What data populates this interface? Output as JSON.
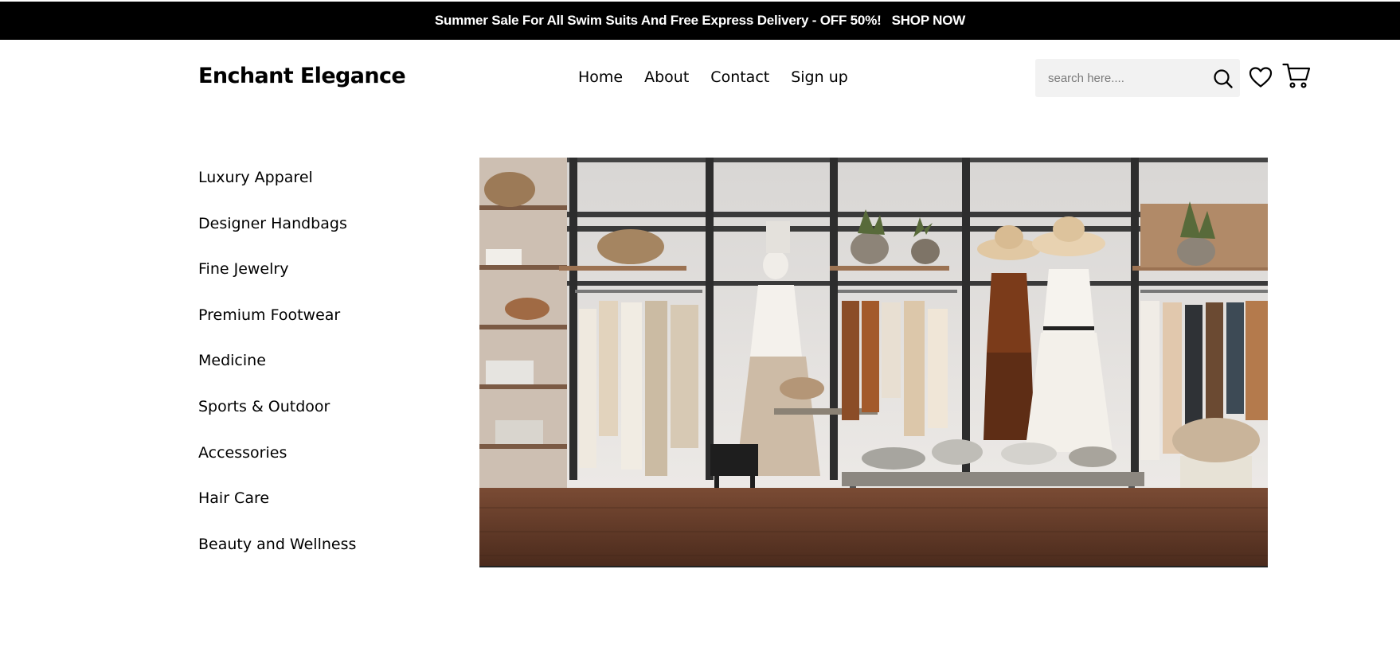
{
  "promo": {
    "text": "Summer Sale For All Swim Suits And Free Express Delivery - OFF 50%!",
    "link": "SHOP NOW"
  },
  "header": {
    "logo": "Enchant Elegance",
    "nav": [
      "Home",
      "About",
      "Contact",
      "Sign up"
    ],
    "search_placeholder": "search here....",
    "icons": [
      "search-icon",
      "heart-icon",
      "cart-icon"
    ]
  },
  "sidebar": {
    "categories": [
      "Luxury Apparel",
      "Designer Handbags",
      "Fine Jewelry",
      "Premium Footwear",
      "Medicine",
      "Sports & Outdoor",
      "Accessories",
      "Hair Care",
      "Beauty and Wellness"
    ]
  },
  "colors": {
    "topbar_bg": "#000000",
    "search_bg": "#f2f2f2",
    "text": "#000000"
  }
}
